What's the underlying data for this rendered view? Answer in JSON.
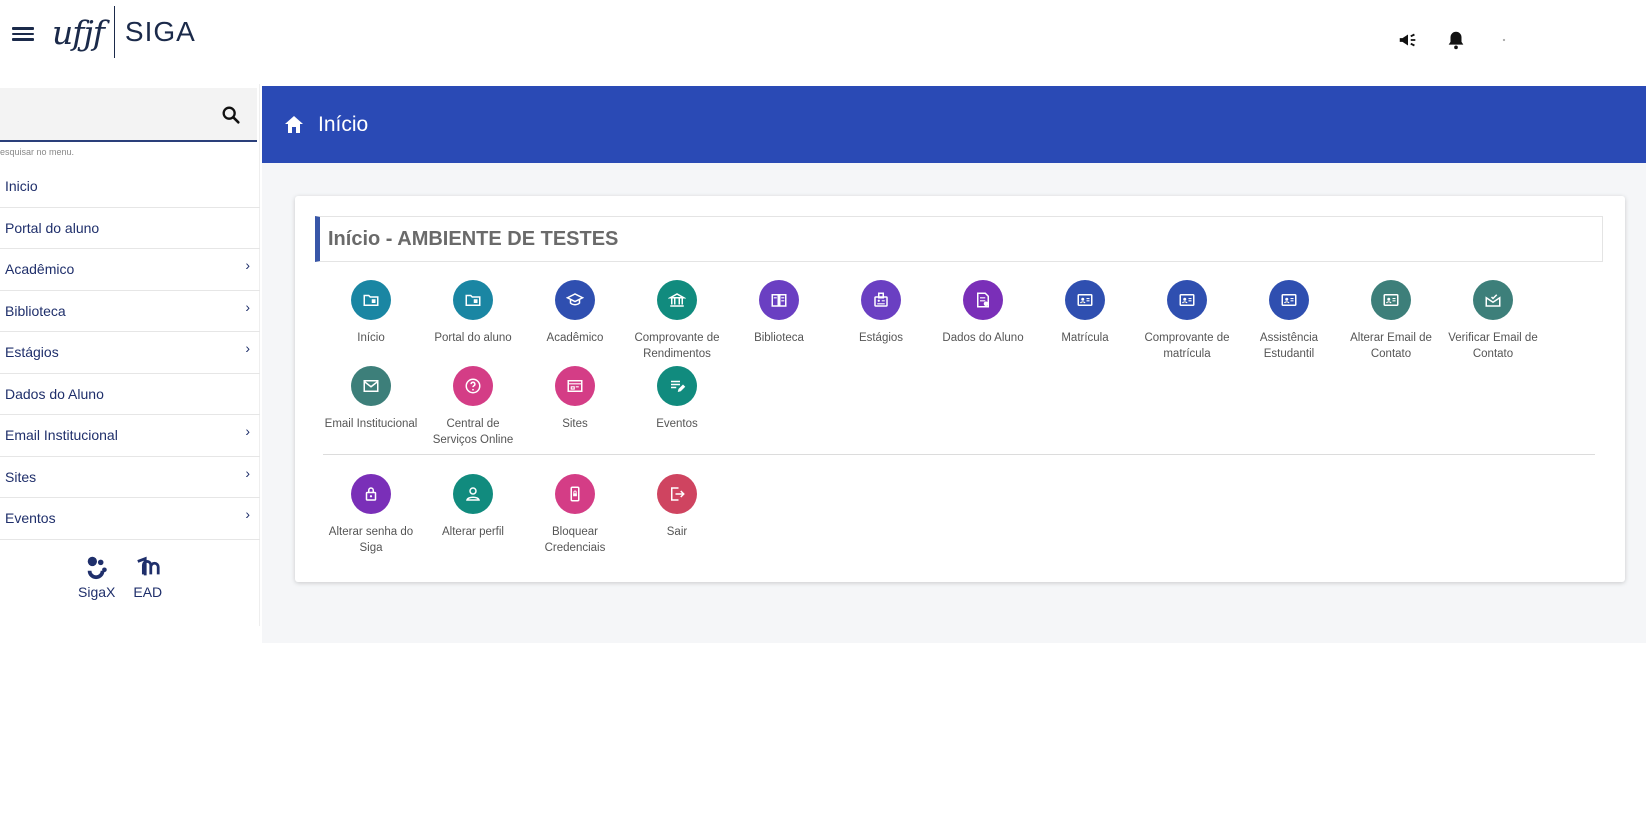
{
  "header": {
    "logo_main": "ufjf",
    "logo_app": "SIGA"
  },
  "sidebar": {
    "search": {
      "value": "",
      "placeholder": "",
      "hint": "esquisar no menu."
    },
    "items": [
      {
        "label": "Inicio",
        "submenu": false
      },
      {
        "label": "Portal do aluno",
        "submenu": false
      },
      {
        "label": "Acadêmico",
        "submenu": true
      },
      {
        "label": "Biblioteca",
        "submenu": true
      },
      {
        "label": "Estágios",
        "submenu": true
      },
      {
        "label": "Dados do Aluno",
        "submenu": false
      },
      {
        "label": "Email Institucional",
        "submenu": true
      },
      {
        "label": "Sites",
        "submenu": true
      },
      {
        "label": "Eventos",
        "submenu": true
      }
    ],
    "apps": [
      {
        "label": "SigaX",
        "icon": "sigax-logo-icon"
      },
      {
        "label": "EAD",
        "icon": "ead-logo-icon"
      }
    ]
  },
  "page": {
    "title": "Início"
  },
  "card": {
    "title": "Início - AMBIENTE DE TESTES",
    "tiles_row1": [
      {
        "label": "Início",
        "color": "#1a86a3",
        "icon": "folder-icon"
      },
      {
        "label": "Portal do aluno",
        "color": "#1a86a3",
        "icon": "folder-icon"
      },
      {
        "label": "Acadêmico",
        "color": "#2f4fb0",
        "icon": "graduation-cap-icon"
      },
      {
        "label": "Comprovante de Rendimentos",
        "color": "#118b7e",
        "icon": "bank-icon"
      },
      {
        "label": "Biblioteca",
        "color": "#6a3fc2",
        "icon": "book-icon"
      },
      {
        "label": "Estágios",
        "color": "#6a3fc2",
        "icon": "badge-icon"
      },
      {
        "label": "Dados do Aluno",
        "color": "#7a2fb8",
        "icon": "document-icon"
      },
      {
        "label": "Matrícula",
        "color": "#2f4fb0",
        "icon": "id-card-icon"
      },
      {
        "label": "Comprovante de matrícula",
        "color": "#2f4fb0",
        "icon": "id-card-icon"
      },
      {
        "label": "Assistência Estudantil",
        "color": "#2f4fb0",
        "icon": "id-card-icon"
      },
      {
        "label": "Alterar Email de Contato",
        "color": "#3d7f7a",
        "icon": "id-card-icon"
      },
      {
        "label": "Verificar Email de Contato",
        "color": "#3d7f7a",
        "icon": "mail-check-icon"
      }
    ],
    "tiles_row2": [
      {
        "label": "Email Institucional",
        "color": "#3d7f7a",
        "icon": "mail-icon"
      },
      {
        "label": "Central de Serviços Online",
        "color": "#d43d86",
        "icon": "help-icon"
      },
      {
        "label": "Sites",
        "color": "#d43d86",
        "icon": "browser-icon"
      },
      {
        "label": "Eventos",
        "color": "#118b7e",
        "icon": "edit-list-icon"
      }
    ],
    "tiles_row3": [
      {
        "label": "Alterar senha do Siga",
        "color": "#7a2fb8",
        "icon": "lock-icon"
      },
      {
        "label": "Alterar perfil",
        "color": "#118b7e",
        "icon": "user-icon"
      },
      {
        "label": "Bloquear Credenciais",
        "color": "#d43d86",
        "icon": "phone-lock-icon"
      },
      {
        "label": "Sair",
        "color": "#cf4460",
        "icon": "logout-icon"
      }
    ]
  }
}
